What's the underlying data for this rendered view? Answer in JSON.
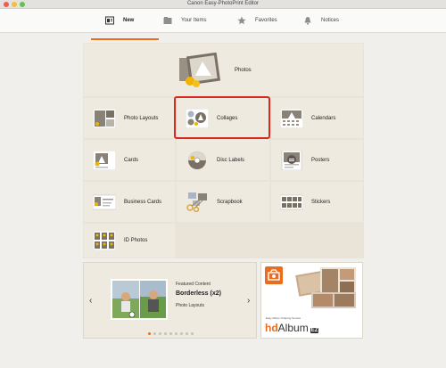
{
  "window": {
    "title": "Canon Easy-PhotoPrint Editor"
  },
  "tabs": [
    {
      "label": "New",
      "icon": "new-grid-icon",
      "active": true
    },
    {
      "label": "Your Items",
      "icon": "folder-icon",
      "active": false
    },
    {
      "label": "Favorites",
      "icon": "star-icon",
      "active": false
    },
    {
      "label": "Notices",
      "icon": "bell-icon",
      "active": false
    }
  ],
  "items": {
    "photos": "Photos",
    "photo_layouts": "Photo Layouts",
    "collages": "Collages",
    "calendars": "Calendars",
    "cards": "Cards",
    "disc_labels": "Disc Labels",
    "posters": "Posters",
    "business_cards": "Business Cards",
    "scrapbook": "Scrapbook",
    "stickers": "Stickers",
    "id_photos": "ID Photos"
  },
  "featured": {
    "heading": "Featured Content",
    "title": "Borderless (x2)",
    "category": "Photo Layouts",
    "prev": "‹",
    "next": "›",
    "page_count": 9,
    "current_page": 1
  },
  "promo": {
    "service_text": "Easy Album Ordering Service",
    "logo_prefix": "hd",
    "logo_main": "Album",
    "logo_badge": "EZ"
  },
  "colors": {
    "accent": "#ec6c1e",
    "selection": "#d9281f"
  }
}
